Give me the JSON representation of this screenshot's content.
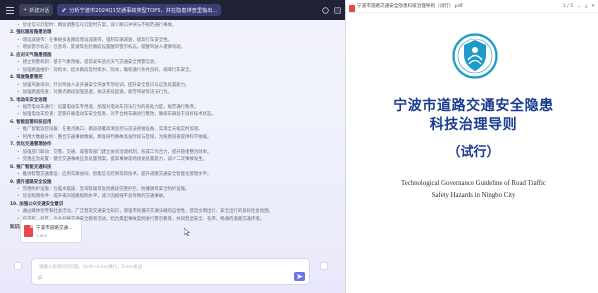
{
  "topbar": {
    "new_chat_label": "新建对话",
    "chat_title": "分析宁波市2024Q1交通事故类型TOP5，并在隐患排查里指出..."
  },
  "chat": {
    "lines": [
      {
        "kind": "sub",
        "text": "优化信号灯配时：精准调整信号灯配时方案，减少路口冲突与不规范通行事故。"
      },
      {
        "kind": "h",
        "text": "2. 强化路段隐患治理"
      },
      {
        "kind": "sub",
        "text": "增设减速带：在事故多发路段增设减速带，强制车辆减速，提高行车安全性。"
      },
      {
        "kind": "sub",
        "text": "增加警示标志：在急弯、陡坡等危险路段设置醒目警示标志，提醒驾驶人谨慎驾驶。"
      },
      {
        "kind": "h",
        "text": "3. 应对天气隐患措施"
      },
      {
        "kind": "sub",
        "text": "建立预警机制：基于气象预报，提前发布恶劣天气交通安全预警信息。"
      },
      {
        "kind": "sub",
        "text": "加强路面维护：对积水、结冰路段及时排水、除冰，确保通行条件良好，保障行车安全。"
      },
      {
        "kind": "h",
        "text": "4. 驾驶隐患管控"
      },
      {
        "kind": "sub",
        "text": "加强驾驶培训：针对驾驶人员开展安全驾驶专项培训，提升安全意识与应急处置能力。"
      },
      {
        "kind": "sub",
        "text": "加强路面巡查：对重点路段加强巡逻，依法查处超速、疲劳驾驶等违法行为。"
      },
      {
        "kind": "h",
        "text": "5. 电动车安全治理"
      },
      {
        "kind": "sub",
        "text": "规范电动车通行：设置电动车专用道，加强对电动车违法行为的查处力度，规范通行秩序。"
      },
      {
        "kind": "sub",
        "text": "加强电动车检查：定期开展电动车安全检查，对不合格车辆进行整改，确保车辆处于良好技术状态。"
      },
      {
        "kind": "h",
        "text": "6. 智能监管科技应用"
      },
      {
        "kind": "sub",
        "text": "推广智能监控设备：在重点路口、路段部署高清监控与违法抓拍设备，实现全天候实时监管。"
      },
      {
        "kind": "sub",
        "text": "利用大数据分析：整合交通事故数据，精准研判事故高发时段与区域，为隐患排查提供科学依据。"
      },
      {
        "kind": "h",
        "text": "7. 优化交通管理协作"
      },
      {
        "kind": "sub",
        "text": "加强部门联动：交警、交通、城管等部门建立协同治理机制，形成工作合力，提升隐患整治效率。"
      },
      {
        "kind": "sub",
        "text": "完善应急处置：健全交通事故应急处置预案，提高事故现场快速处置能力，减少二次事故发生。"
      },
      {
        "kind": "h",
        "text": "8. 推广智能交通科技"
      },
      {
        "kind": "sub",
        "text": "推进智慧交通建设：应用车路协同、智能信号控制等新技术，提升道路交通安全智能化管理水平。"
      },
      {
        "kind": "h",
        "text": "9. 提升道路安全设施"
      },
      {
        "kind": "sub",
        "text": "完善防护设施：在临水临崖、急弯陡坡等危险路段完善护栏、防撞墩等安全防护设施。"
      },
      {
        "kind": "sub",
        "text": "优化照明条件：提升夜间道路照明水平，减少因视线不良导致的交通事故。"
      },
      {
        "kind": "h",
        "text": "10. 加强公众交通安全意识"
      },
      {
        "kind": "sub",
        "text": "通过媒体宣传和社会活动，广泛普及交通安全知识，增强市民遵守交通法规的自觉性，营造文明出行、安全出行的良好社会氛围。"
      },
      {
        "kind": "sub",
        "text": "在学校、社区、企业开展交通安全教育活动，结合典型事故案例进行警示教育，共同营造安全、有序、畅通的道路交通环境。"
      }
    ],
    "refs_label": "知识库文档",
    "file": {
      "name": "宁波市道路交通...",
      "size": "1.8KB"
    },
    "input_placeholder": "请输入你想问的问题，Shift+Enter换行，Enter发送"
  },
  "pdf": {
    "filename": "宁波市道路交通安全隐患科技治理导则（试行）.pdf",
    "page_indicator": "1 / 5",
    "title_line1": "宁波市道路交通安全隐患",
    "title_line2": "科技治理导则",
    "title_line3": "（试行）",
    "en_line1": "Technological Governance Guideline of Road Traffic",
    "en_line2": "Safety Hazards in Ningbo City"
  },
  "colors": {
    "topbar_bg": "#1f2335",
    "accent": "#6b71f2",
    "pdf_title": "#1a3b8f",
    "emblem": "#1d9bc4"
  },
  "icons": {
    "menu": "menu-icon",
    "new_chat": "plus-icon",
    "pdf": "pdf-file-icon",
    "send": "send-icon",
    "attach": "paperclip-icon",
    "emblem": "traffic-emblem-icon"
  }
}
